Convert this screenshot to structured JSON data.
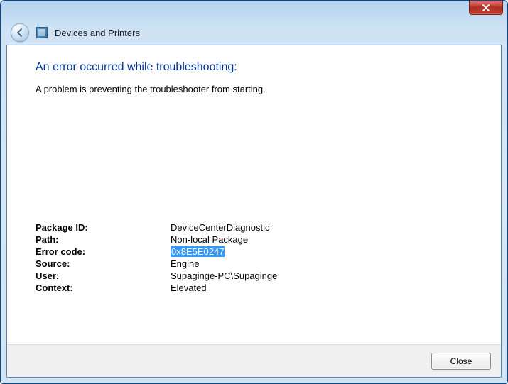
{
  "header": {
    "title": "Devices and Printers"
  },
  "main": {
    "heading": "An error occurred while troubleshooting:",
    "message": "A problem is preventing the troubleshooter from starting."
  },
  "details": {
    "package_id_label": "Package ID:",
    "package_id_value": "DeviceCenterDiagnostic",
    "path_label": "Path:",
    "path_value": "Non-local Package",
    "error_code_label": "Error code:",
    "error_code_value": "0x8E5E0247",
    "source_label": "Source:",
    "source_value": "Engine",
    "user_label": "User:",
    "user_value": "Supaginge-PC\\Supaginge",
    "context_label": "Context:",
    "context_value": "Elevated"
  },
  "footer": {
    "close_label": "Close"
  }
}
